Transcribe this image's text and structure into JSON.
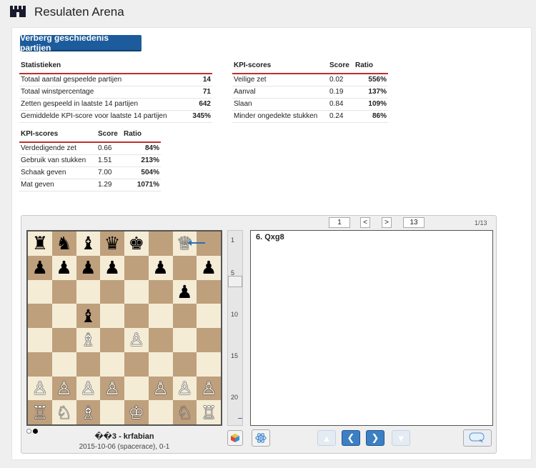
{
  "app": {
    "title": "Resulaten Arena"
  },
  "toggle_history_button": "Verberg geschiedenis partijen",
  "stats": {
    "header": "Statistieken",
    "rows": [
      {
        "label": "Totaal aantal gespeelde partijen",
        "value": "14"
      },
      {
        "label": "Totaal winstpercentage",
        "value": "71"
      },
      {
        "label": "Zetten gespeeld in laatste 14 partijen",
        "value": "642"
      },
      {
        "label": "Gemiddelde KPI-score voor laatste 14 partijen",
        "value": "345%"
      }
    ]
  },
  "kpi_left": {
    "headers": [
      "KPI-scores",
      "Score",
      "Ratio"
    ],
    "rows": [
      {
        "label": "Verdedigende zet",
        "score": "0.66",
        "ratio": "84%"
      },
      {
        "label": "Gebruik van stukken",
        "score": "1.51",
        "ratio": "213%"
      },
      {
        "label": "Schaak geven",
        "score": "7.00",
        "ratio": "504%"
      },
      {
        "label": "Mat geven",
        "score": "1.29",
        "ratio": "1071%"
      }
    ]
  },
  "kpi_right": {
    "headers": [
      "KPI-scores",
      "Score",
      "Ratio"
    ],
    "rows": [
      {
        "label": "Veilige zet",
        "score": "0.02",
        "ratio": "556%"
      },
      {
        "label": "Aanval",
        "score": "0.19",
        "ratio": "137%"
      },
      {
        "label": "Slaan",
        "score": "0.84",
        "ratio": "109%"
      },
      {
        "label": "Minder ongedekte stukken",
        "score": "0.24",
        "ratio": "86%"
      }
    ]
  },
  "board": {
    "rows": [
      "♜♞♝♛♚.♕.",
      "♟♟♟♟.♟.♟",
      "......♟.",
      "..♝.....",
      "..♗.♙...",
      "........",
      "♙♙♙♙.♙♙♙",
      "♖♘♗.♔.♘♖"
    ],
    "white_pieces": "♔♕♖♗♘♙",
    "light_square_color": "#f5ecd6",
    "dark_square_color": "#bfa07c"
  },
  "game": {
    "title": "��3 - krfabian",
    "subtitle": "2015-10-06 (spacerace), 0-1"
  },
  "navigation": {
    "first": "1",
    "prev": "<",
    "next": ">",
    "last": "13",
    "move_count": "1/13"
  },
  "scroller_ticks": [
    "1",
    "5",
    "10",
    "15",
    "20"
  ],
  "current_move": "6. Qxg8"
}
